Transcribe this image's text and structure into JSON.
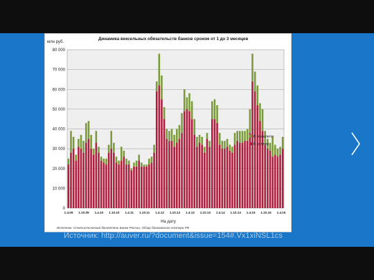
{
  "caption": "Источник: http://auver.ru/?document&issue=154#.Vx1xiNSL1cs",
  "colors": {
    "slide_bg": "#1976c8",
    "rub": "#b01c3c",
    "fx": "#7a9a3a"
  },
  "chart_data": {
    "type": "bar",
    "stacked": true,
    "title": "Динамика вексельных обязательств банков сроком от 1 до 3 месяцев",
    "ylabel": "млн руб.",
    "xlabel": "На дату",
    "source_note": "Источник: Статистический бюллетень Банка России, Обзор банковского сектора РФ",
    "ylim": [
      0,
      80000
    ],
    "yticks": [
      "0",
      "10 000",
      "20 000",
      "30 000",
      "40 000",
      "50 000",
      "60 000",
      "70 000",
      "80 000"
    ],
    "xtick_labels": [
      "1.4.09",
      "1.10.09",
      "1.4.10",
      "1.10.10",
      "1.4.11",
      "1.10.11",
      "1.4.12",
      "1.10.12",
      "1.4.13",
      "1.10.13",
      "1.4.14",
      "1.10.14",
      "1.4.15",
      "1.10.15",
      "1.4.16"
    ],
    "grid": true,
    "legend_position": "right",
    "legend": [
      "В инвалюте",
      "В рублях"
    ],
    "series": [
      {
        "name": "В рублях",
        "values": [
          22000,
          28000,
          30000,
          24000,
          31000,
          30000,
          28000,
          33000,
          35000,
          30000,
          27000,
          33000,
          28000,
          24000,
          23000,
          22000,
          28000,
          30000,
          28000,
          23000,
          22000,
          24000,
          26000,
          22000,
          22000,
          19000,
          21000,
          21000,
          24000,
          21000,
          21000,
          21000,
          22000,
          23000,
          28000,
          59000,
          62000,
          55000,
          45000,
          35000,
          34000,
          34000,
          31000,
          33000,
          35000,
          38000,
          49000,
          50000,
          49000,
          45000,
          37000,
          31000,
          33000,
          32000,
          28000,
          35000,
          31000,
          45000,
          45000,
          43000,
          32000,
          30000,
          30000,
          31000,
          29000,
          28000,
          32000,
          34000,
          33000,
          33000,
          34000,
          34000,
          38000,
          64000,
          59000,
          52000,
          44000,
          39000,
          32000,
          30000,
          29000,
          26000,
          27000,
          26000,
          27000,
          30000
        ]
      },
      {
        "name": "В инвалюте",
        "values": [
          3000,
          11000,
          6000,
          3000,
          4000,
          7000,
          6000,
          10000,
          9000,
          7000,
          3000,
          6000,
          3000,
          2000,
          2000,
          3000,
          4000,
          9000,
          5000,
          3000,
          2000,
          7000,
          3000,
          3000,
          2000,
          1000,
          2000,
          3000,
          3000,
          2000,
          1000,
          1000,
          3000,
          3000,
          4000,
          5000,
          16000,
          12000,
          6000,
          5000,
          5000,
          6000,
          6000,
          7000,
          7000,
          10000,
          11000,
          6000,
          9000,
          9000,
          8000,
          5000,
          4000,
          4000,
          3000,
          3000,
          3000,
          9000,
          10000,
          9000,
          6000,
          4000,
          4000,
          4000,
          3000,
          3000,
          6000,
          5000,
          6000,
          6000,
          5000,
          6000,
          12000,
          14000,
          10000,
          10000,
          9000,
          11000,
          7000,
          5000,
          4000,
          10000,
          5000,
          4000,
          4000,
          6000
        ]
      }
    ]
  }
}
